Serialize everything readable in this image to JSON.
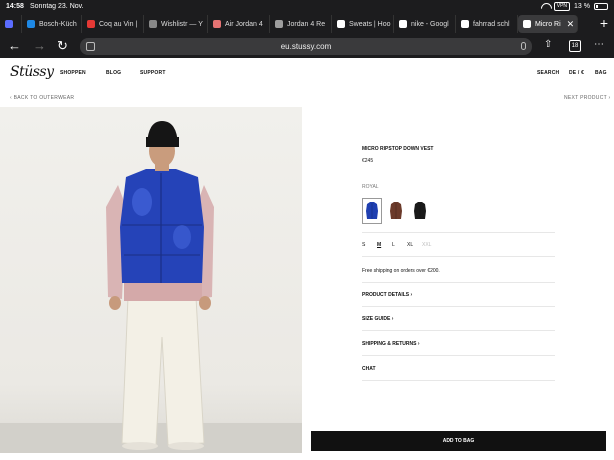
{
  "status": {
    "time": "14:58",
    "date": "Sonntag 23. Nov.",
    "vpn": "VPN",
    "battery": "13 %"
  },
  "tabs": [
    {
      "label": "",
      "color": "#5b6cff"
    },
    {
      "label": "Bosch-Küch",
      "color": "#1e88e5"
    },
    {
      "label": "Coq au Vin |",
      "color": "#e53935"
    },
    {
      "label": "Wishlistr — Y",
      "color": "#888888"
    },
    {
      "label": "Air Jordan 4",
      "color": "#e57373"
    },
    {
      "label": "Jordan 4 Re",
      "color": "#9e9e9e"
    },
    {
      "label": "Sweats | Hoo",
      "color": "#ffffff"
    },
    {
      "label": "nike - Googl",
      "color": "#ffffff"
    },
    {
      "label": "fahrrad schl",
      "color": "#ffffff"
    },
    {
      "label": "Micro Ri",
      "color": "#ffffff",
      "active": true
    }
  ],
  "browser": {
    "url": "eu.stussy.com",
    "tab_count": "18",
    "back": "←",
    "forward": "→",
    "reload": "↻",
    "share": "⇧",
    "more": "⋯",
    "new_tab": "+",
    "close_tab": "✕"
  },
  "site": {
    "logo": "Stüssy",
    "nav": {
      "shop": "SHOPPEN",
      "blog": "BLOG",
      "support": "SUPPORT",
      "search": "SEARCH",
      "locale": "DE / €",
      "bag": "BAG"
    },
    "back_link": "‹ BACK TO OUTERWEAR",
    "next_link": "NEXT PRODUCT ›"
  },
  "product": {
    "title": "MICRO RIPSTOP DOWN VEST",
    "price": "€245",
    "color_label": "ROYAL",
    "swatch_colors": [
      "#1f3fb0",
      "#6b3a2a",
      "#1a1a1a"
    ],
    "sizes": [
      {
        "label": "S",
        "state": ""
      },
      {
        "label": "M",
        "state": "sel"
      },
      {
        "label": "L",
        "state": ""
      },
      {
        "label": "XL",
        "state": ""
      },
      {
        "label": "XXL",
        "state": "na"
      }
    ],
    "shipping": "Free shipping on orders over €200.",
    "accordions": [
      "PRODUCT DETAILS ›",
      "SIZE GUIDE ›",
      "SHIPPING & RETURNS ›",
      "CHAT"
    ],
    "add_to_bag": "ADD TO BAG"
  }
}
